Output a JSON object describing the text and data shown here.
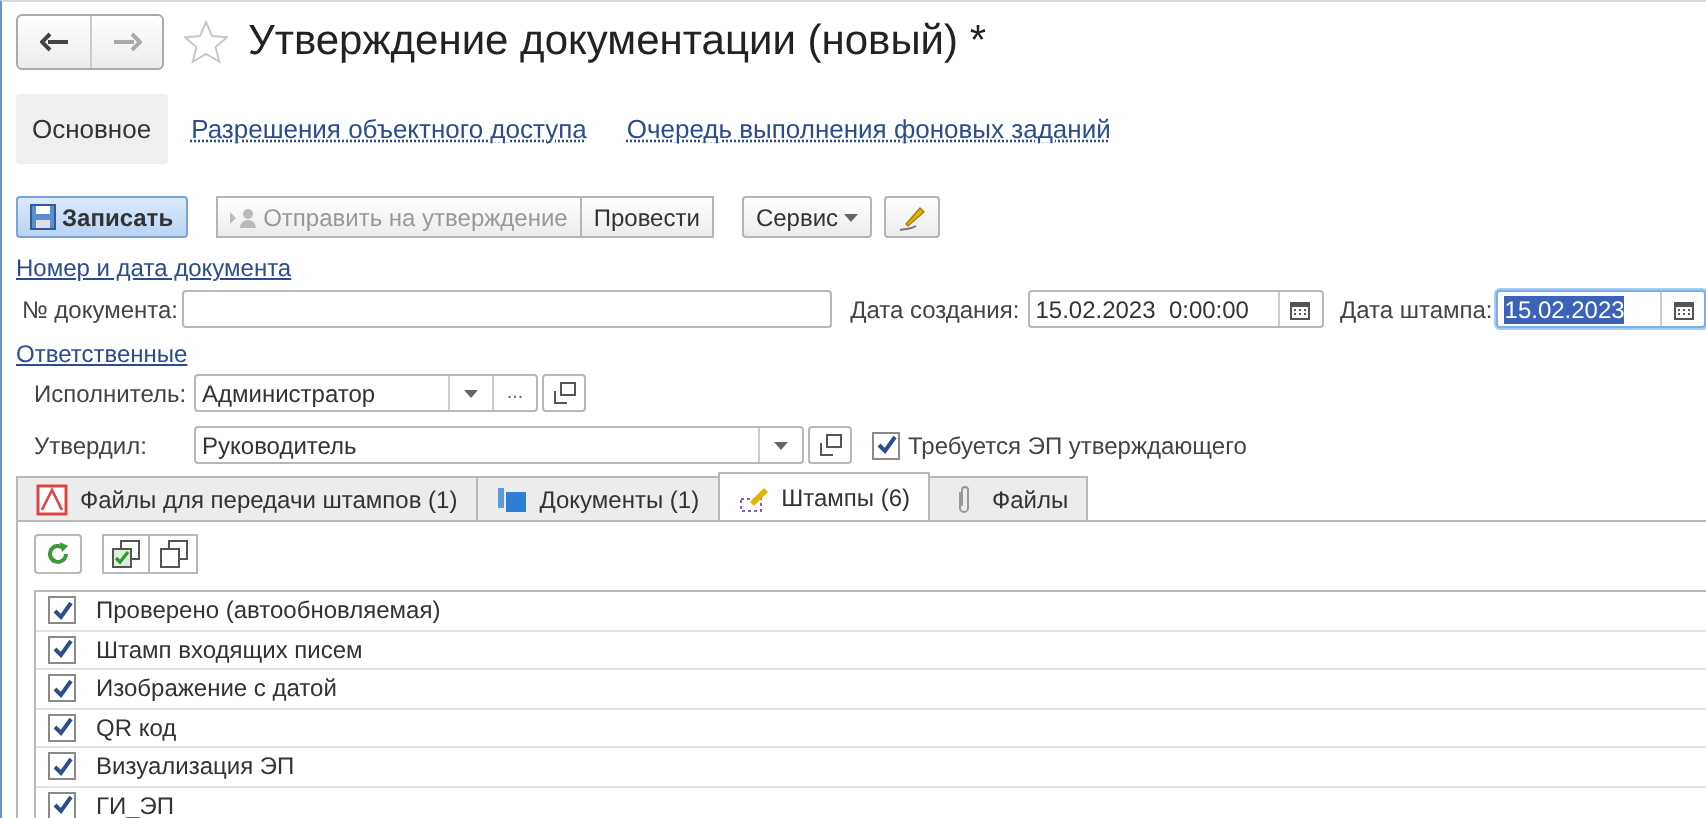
{
  "title": "Утверждение документации (новый) *",
  "nav_tabs": [
    {
      "label": "Основное",
      "selected": true
    },
    {
      "label": "Разрешения объектного доступа",
      "selected": false
    },
    {
      "label": "Очередь выполнения фоновых заданий",
      "selected": false
    }
  ],
  "toolbar": {
    "save": "Записать",
    "send": {
      "label": "Отправить на утверждение",
      "disabled": true
    },
    "post": "Провести",
    "service": "Сервис"
  },
  "group_number": "Номер и дата документа",
  "doc_number": {
    "label": "№ документа:"
  },
  "created": {
    "label": "Дата создания:",
    "value": "15.02.2023  0:00:00"
  },
  "stamp_date": {
    "label": "Дата штампа:",
    "value": "15.02.2023"
  },
  "group_resp": "Ответственные",
  "executor": {
    "label": "Исполнитель:",
    "value": "Администратор",
    "select_button": "..."
  },
  "approver": {
    "label": "Утвердил:",
    "value": "Руководитель"
  },
  "require_sign": {
    "label": "Требуется ЭП утверждающего",
    "checked": true
  },
  "tabs": [
    {
      "label": "Файлы для передачи штампов (1)",
      "kind": "pdf",
      "selected": false
    },
    {
      "label": "Документы (1)",
      "kind": "docs",
      "selected": false
    },
    {
      "label": "Штампы (6)",
      "kind": "stamp",
      "selected": true
    },
    {
      "label": "Файлы",
      "kind": "clip",
      "selected": false
    }
  ],
  "stamps": [
    {
      "name": "Проверено (автообновляемая)",
      "checked": true
    },
    {
      "name": "Штамп входящих писем",
      "checked": true
    },
    {
      "name": "Изображение с датой",
      "checked": true
    },
    {
      "name": "QR код",
      "checked": true
    },
    {
      "name": "Визуализация ЭП",
      "checked": true
    },
    {
      "name": "ГИ_ЭП",
      "checked": true
    }
  ]
}
